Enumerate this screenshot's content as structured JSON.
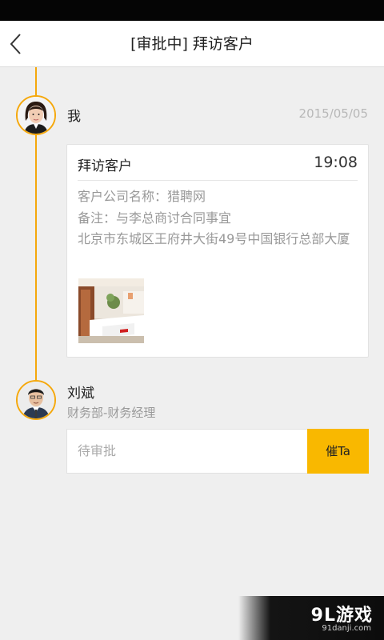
{
  "header": {
    "title": "[审批中] 拜访客户"
  },
  "timeline": {
    "entries": [
      {
        "name": "我",
        "date": "2015/05/05",
        "card": {
          "title": "拜访客户",
          "time": "19:08",
          "company": "客户公司名称：猎聘网",
          "note": "备注：与李总商讨合同事宜",
          "address": "北京市东城区王府井大街49号中国银行总部大厦"
        }
      },
      {
        "name": "刘斌",
        "department": "财务部-财务经理",
        "status": "待审批",
        "urge_label": "催Ta"
      }
    ]
  },
  "watermark": {
    "logo": "9L游戏",
    "url": "91danji.com"
  },
  "colors": {
    "accent": "#f5a80c",
    "button": "#f9b800",
    "background": "#efefef"
  },
  "icons": {
    "back": "chevron-left-icon"
  }
}
